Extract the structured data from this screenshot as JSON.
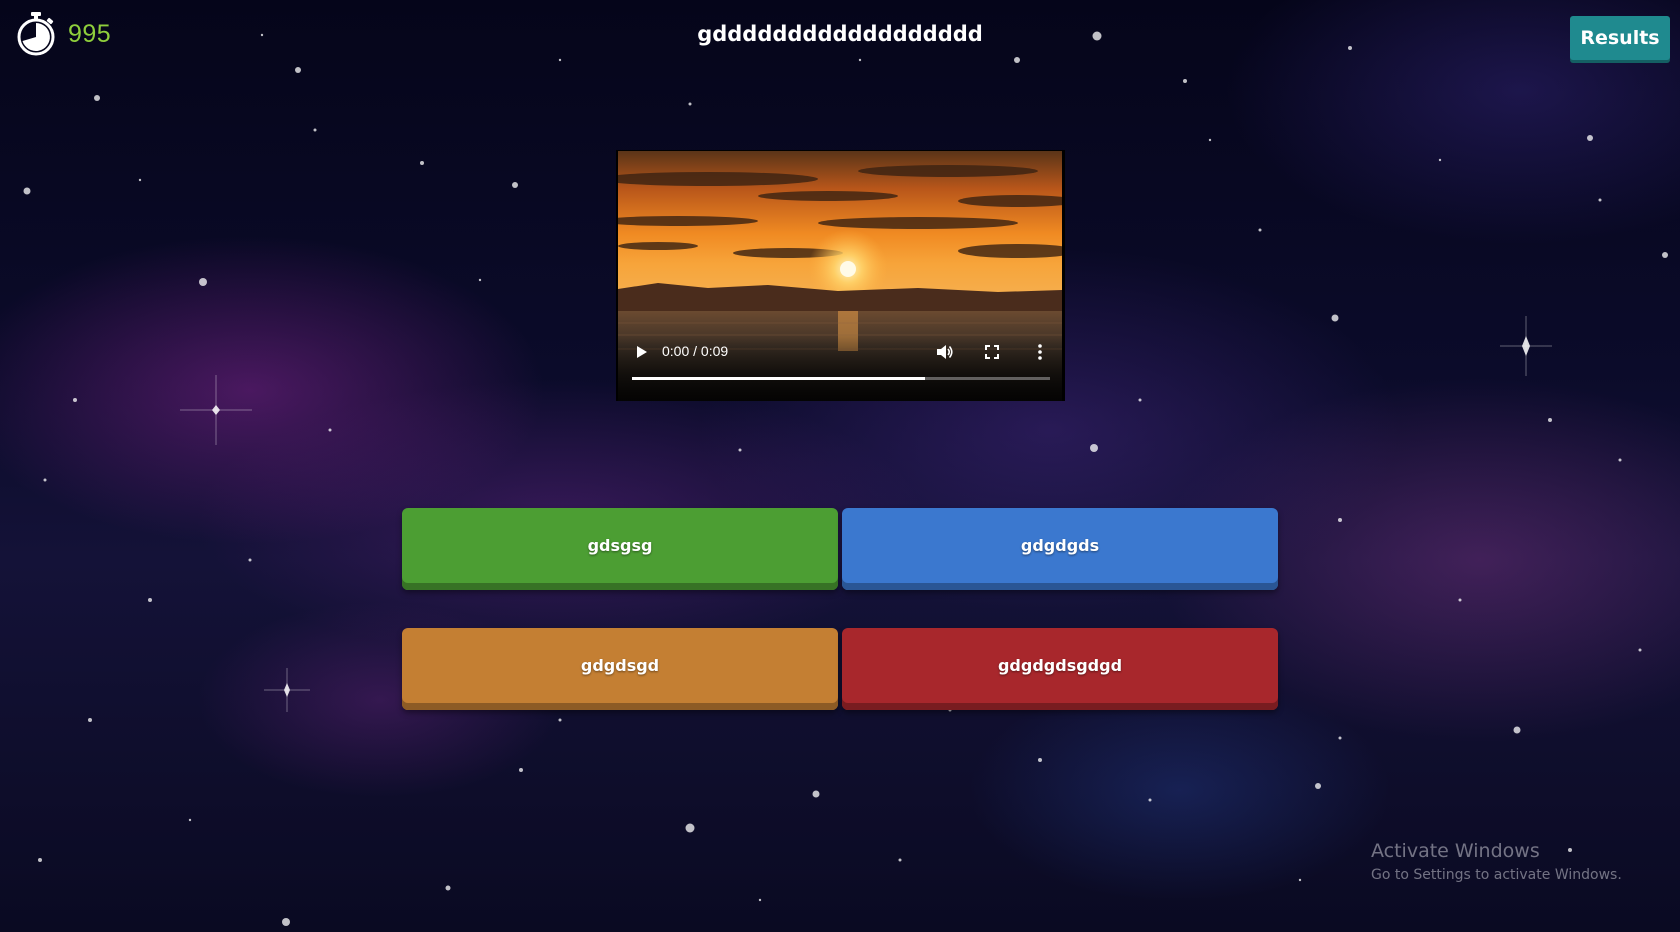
{
  "header": {
    "timer_value": "995",
    "timer_color": "#8fcf3c",
    "timer_icon": "stopwatch-icon",
    "question": "gdddddddddddddddddd",
    "results_label": "Results",
    "results_color": "#1f8a8f"
  },
  "video": {
    "time": "0:00 / 0:09",
    "played_fraction": 0.7,
    "controls": [
      "play-icon",
      "volume-icon",
      "fullscreen-icon",
      "more-options-icon"
    ]
  },
  "answers": [
    {
      "label": "gdsgsg",
      "color": "#4c9e33"
    },
    {
      "label": "gdgdgds",
      "color": "#3b78cf"
    },
    {
      "label": "gdgdsgd",
      "color": "#c47f33"
    },
    {
      "label": "gdgdgdsgdgd",
      "color": "#a8272c"
    }
  ],
  "watermark": {
    "title": "Activate Windows",
    "subtitle": "Go to Settings to activate Windows."
  }
}
